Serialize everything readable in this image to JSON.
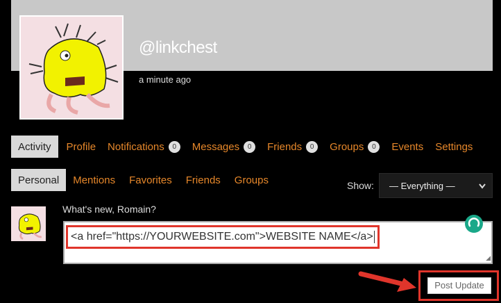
{
  "profile": {
    "username": "@linkchest",
    "last_active": "a minute ago"
  },
  "nav": {
    "items": [
      {
        "label": "Activity",
        "active": true
      },
      {
        "label": "Profile"
      },
      {
        "label": "Notifications",
        "count": "0"
      },
      {
        "label": "Messages",
        "count": "0"
      },
      {
        "label": "Friends",
        "count": "0"
      },
      {
        "label": "Groups",
        "count": "0"
      },
      {
        "label": "Events"
      },
      {
        "label": "Settings"
      }
    ]
  },
  "subnav": {
    "items": [
      {
        "label": "Personal",
        "active": true
      },
      {
        "label": "Mentions"
      },
      {
        "label": "Favorites"
      },
      {
        "label": "Friends"
      },
      {
        "label": "Groups"
      }
    ]
  },
  "filter": {
    "label": "Show:",
    "selected": "— Everything —"
  },
  "post_form": {
    "prompt": "What's new, Romain?",
    "value": "<a href=\"https://YOURWEBSITE.com\">WEBSITE NAME</a>",
    "submit_label": "Post Update"
  },
  "colors": {
    "accent": "#e6872a",
    "highlight": "#e0352b",
    "cover": "#c8c8c8"
  }
}
